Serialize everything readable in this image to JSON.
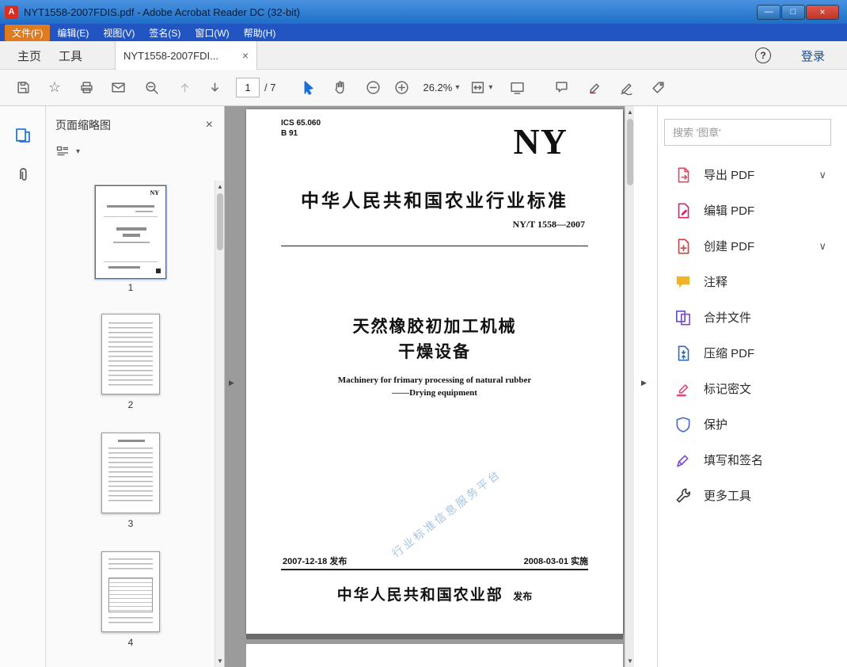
{
  "window": {
    "title": "NYT1558-2007FDIS.pdf - Adobe Acrobat Reader DC (32-bit)"
  },
  "menu": {
    "items": [
      {
        "label": "文件(F)"
      },
      {
        "label": "编辑(E)"
      },
      {
        "label": "视图(V)"
      },
      {
        "label": "签名(S)"
      },
      {
        "label": "窗口(W)"
      },
      {
        "label": "帮助(H)"
      }
    ]
  },
  "tabs": {
    "home": "主页",
    "tools": "工具",
    "doc_tab": "NYT1558-2007FDI...",
    "sign_in": "登录"
  },
  "toolbar": {
    "page_number": "1",
    "page_total": "/ 7",
    "zoom_level": "26.2%"
  },
  "thumbnail_panel": {
    "title": "页面缩略图",
    "pages": [
      {
        "number": "1"
      },
      {
        "number": "2"
      },
      {
        "number": "3"
      },
      {
        "number": "4"
      }
    ]
  },
  "document": {
    "ics": "ICS 65.060",
    "b_class": "B 91",
    "logo": "NY",
    "standard_title": "中华人民共和国农业行业标准",
    "standard_number": "NY/T 1558—2007",
    "title_line1": "天然橡胶初加工机械",
    "title_line2": "干燥设备",
    "subtitle_en1": "Machinery for frimary processing of natural rubber",
    "subtitle_en2": "——Drying equipment",
    "watermark": "行业标准信息服务平台",
    "issue_date": "2007-12-18 发布",
    "impl_date": "2008-03-01 实施",
    "publisher": "中华人民共和国农业部",
    "publisher_suffix": "发布"
  },
  "right_panel": {
    "search_placeholder": "搜索 '图章'",
    "tools": [
      {
        "label": "导出 PDF",
        "icon": "export-pdf-icon",
        "chevron": true
      },
      {
        "label": "编辑 PDF",
        "icon": "edit-pdf-icon",
        "chevron": false
      },
      {
        "label": "创建 PDF",
        "icon": "create-pdf-icon",
        "chevron": true
      },
      {
        "label": "注释",
        "icon": "comment-icon",
        "chevron": false
      },
      {
        "label": "合并文件",
        "icon": "combine-files-icon",
        "chevron": false
      },
      {
        "label": "压缩 PDF",
        "icon": "compress-pdf-icon",
        "chevron": false
      },
      {
        "label": "标记密文",
        "icon": "redact-icon",
        "chevron": false
      },
      {
        "label": "保护",
        "icon": "protect-icon",
        "chevron": false
      },
      {
        "label": "填写和签名",
        "icon": "fill-sign-icon",
        "chevron": false
      },
      {
        "label": "更多工具",
        "icon": "more-tools-icon",
        "chevron": false
      }
    ]
  },
  "colors": {
    "titlebar_blue": "#1e6fc7",
    "menubar_blue": "#2254c2",
    "menu_highlight_orange": "#e07a1f",
    "doc_background_gray": "#9b9b9b",
    "accent_blue": "#1a6fd4",
    "export_red": "#e04a5f",
    "edit_pink": "#d6246e",
    "create_red": "#dc3a3a",
    "comment_yellow": "#f0b429",
    "combine_purple": "#5553c7",
    "compress_blue": "#2d6cc4",
    "redact_pink": "#e0457b",
    "protect_blue": "#4a67d6",
    "fillsign_purple": "#7a4fd0"
  },
  "icons": {
    "acrobat_badge": "A",
    "minimize": "—",
    "maximize": "□",
    "close": "×",
    "tab_close": "×",
    "panel_close": "×",
    "help": "?",
    "dropdown": "▾",
    "chevron_down": "∨",
    "scroll_up": "▲",
    "scroll_down": "▼",
    "collapse_handle": "▶",
    "star": "☆"
  }
}
